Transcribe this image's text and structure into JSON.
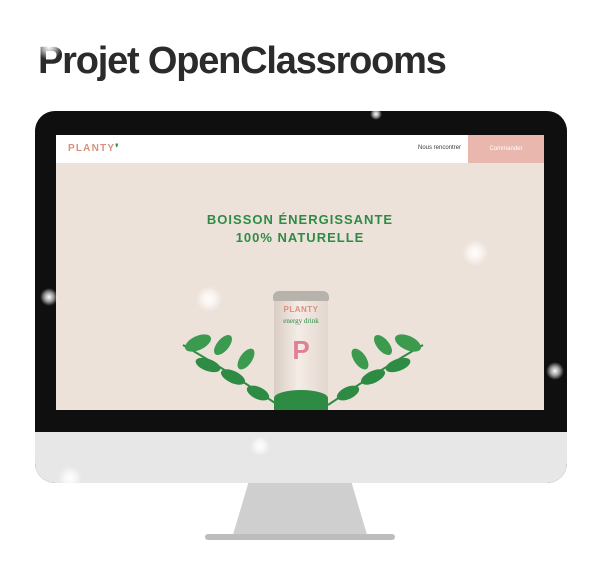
{
  "headline": "Projet OpenClassrooms",
  "site": {
    "logo": "PLANTY",
    "nav_link": "Nous rencontrer",
    "cta": "Commander",
    "hero_line1": "BOISSON ÉNERGISSANTE",
    "hero_line2": "100% NATURELLE"
  },
  "can": {
    "logo": "PLANTY",
    "subtitle": "energy drink",
    "mark": "P"
  },
  "colors": {
    "accent_green": "#2e8b43",
    "brand_pink": "#d8907f",
    "cta_bg": "#e9b7ad",
    "hero_bg": "#ede2da"
  }
}
